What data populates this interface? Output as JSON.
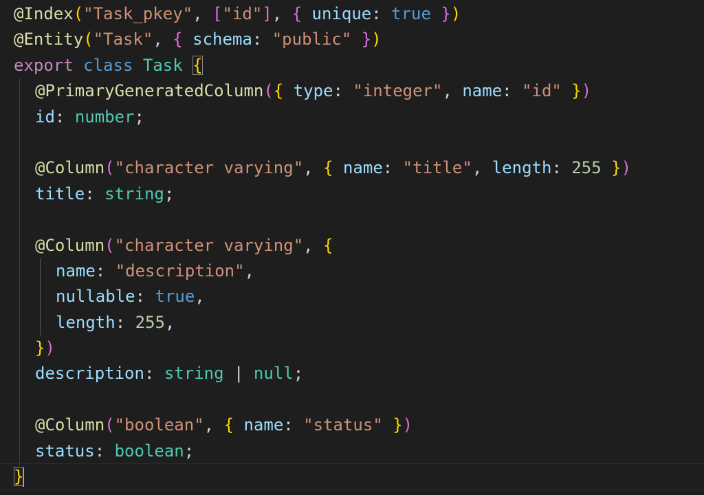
{
  "editor": {
    "theme": {
      "background": "#1e1e1e",
      "keyword": "#569cd6",
      "control_keyword": "#c586c0",
      "type": "#4ec9b0",
      "function": "#dcdcaa",
      "string": "#ce9178",
      "property": "#9cdcfe",
      "number": "#b5cea8",
      "punctuation": "#d4d4d4"
    },
    "tokens": {
      "at": "@",
      "index_decorator": "Index",
      "entity_decorator": "Entity",
      "primary_column_decorator": "PrimaryGeneratedColumn",
      "column_decorator": "Column",
      "task_pkey_str": "\"Task_pkey\"",
      "id_str": "\"id\"",
      "task_str": "\"Task\"",
      "public_str": "\"public\"",
      "integer_str": "\"integer\"",
      "varchar_str": "\"character varying\"",
      "title_str": "\"title\"",
      "description_str": "\"description\"",
      "boolean_str": "\"boolean\"",
      "status_str": "\"status\"",
      "unique_key": "unique",
      "schema_key": "schema",
      "type_key": "type",
      "name_key": "name",
      "length_key": "length",
      "nullable_key": "nullable",
      "true_literal": "true",
      "null_literal": "null",
      "export_kw": "export",
      "class_kw": "class",
      "class_name": "Task",
      "id_prop": "id",
      "title_prop": "title",
      "description_prop": "description",
      "status_prop": "status",
      "number_type": "number",
      "string_type": "string",
      "boolean_type": "boolean",
      "length_value": "255"
    }
  }
}
